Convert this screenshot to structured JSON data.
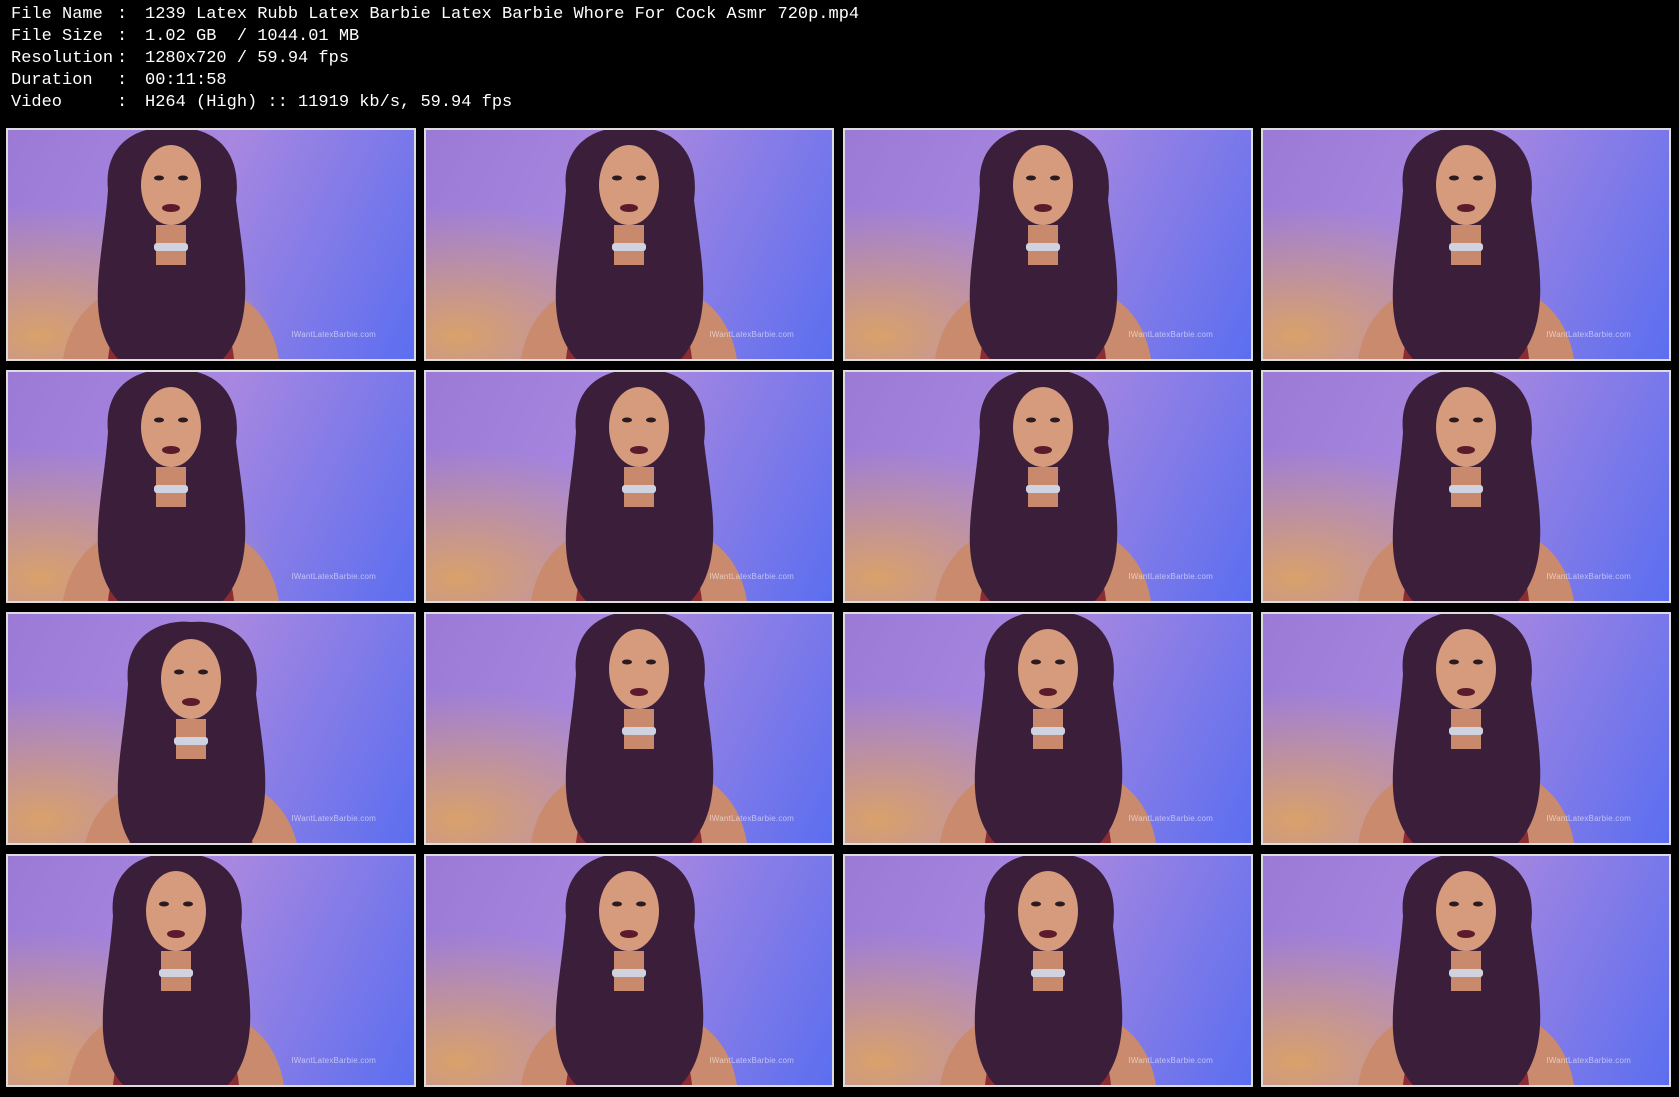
{
  "info": [
    {
      "label": "File Name",
      "sep": ":",
      "value": "1239 Latex Rubb Latex Barbie Latex Barbie Whore For Cock Asmr 720p.mp4"
    },
    {
      "label": "File Size",
      "sep": ":",
      "value": "1.02 GB  / 1044.01 MB"
    },
    {
      "label": "Resolution",
      "sep": ":",
      "value": "1280x720 / 59.94 fps"
    },
    {
      "label": "Duration",
      "sep": ":",
      "value": "00:11:58"
    },
    {
      "label": "Video",
      "sep": ":",
      "value": "H264 (High) :: 11919 kb/s, 59.94 fps"
    }
  ],
  "thumbnails": {
    "rows": 4,
    "columns": 4,
    "watermark": "IWantLatexBarbie.com"
  },
  "colors": {
    "background": "#000000",
    "text": "#ffffff",
    "thumb_border": "#dcdcdc",
    "backdrop_purple": "#9b7ad6",
    "backdrop_blue": "#5b6ef0",
    "warm_light": "#d9a16a",
    "hair": "#3b1f3a",
    "latex_red": "#8a2d33"
  }
}
